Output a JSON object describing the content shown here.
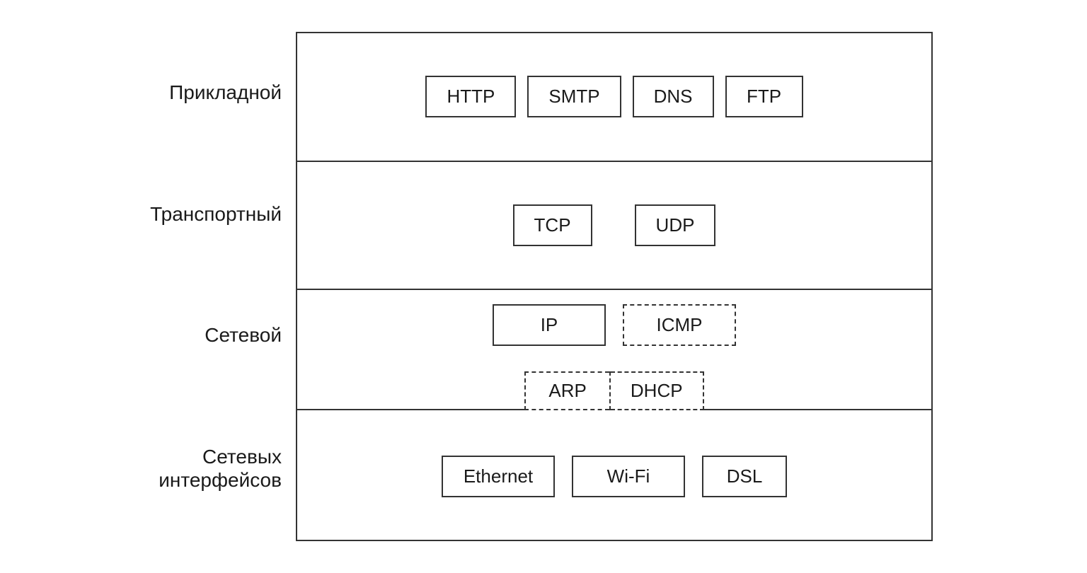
{
  "layers": {
    "application": {
      "label": "Прикладной",
      "protocols": [
        "HTTP",
        "SMTP",
        "DNS",
        "FTP"
      ]
    },
    "transport": {
      "label": "Транспортный",
      "protocols": [
        "TCP",
        "UDP"
      ]
    },
    "network": {
      "label": "Сетевой",
      "solid_protocols": [
        "IP"
      ],
      "dashed_protocols": [
        "ICMP"
      ],
      "boundary_protocols": [
        "ARP",
        "DHCP"
      ]
    },
    "interface": {
      "label_line1": "Сетевых",
      "label_line2": "интерфейсов",
      "protocols": [
        "Ethernet",
        "Wi-Fi",
        "DSL"
      ]
    }
  }
}
